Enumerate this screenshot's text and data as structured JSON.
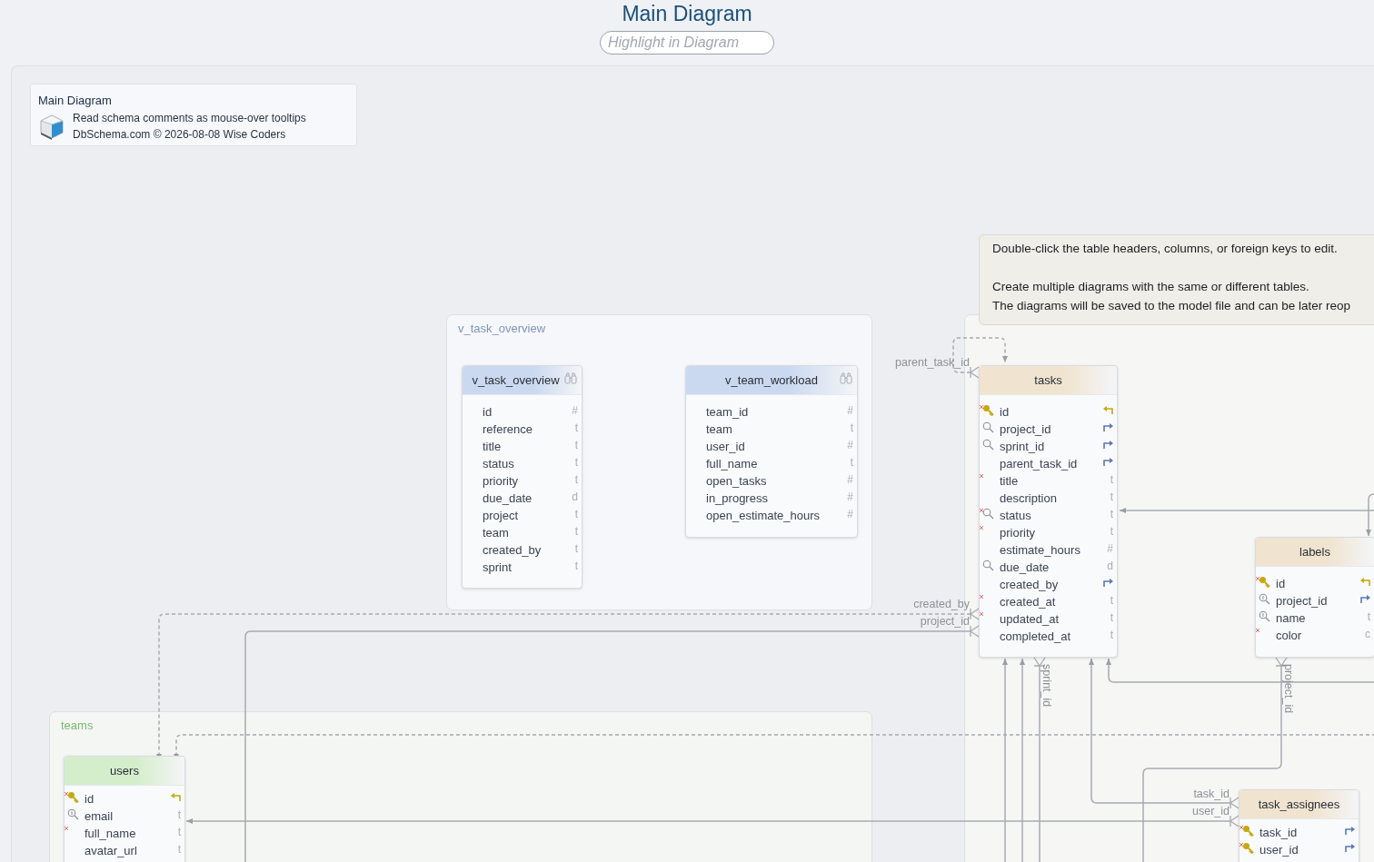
{
  "title": "Main Diagram",
  "search": {
    "placeholder": "Highlight in Diagram"
  },
  "info": {
    "title": "Main Diagram",
    "lines": [
      "Read schema comments as mouse-over tooltips",
      "DbSchema.com © 2026-08-08 Wise Coders"
    ]
  },
  "tooltip": {
    "paragraphs": [
      [
        "Double-click the table headers, columns, or foreign keys to edit."
      ],
      [
        "Create multiple diagrams with the same or different tables.",
        "The diagrams will be saved to the model file and can be later reop"
      ]
    ]
  },
  "groups": [
    {
      "label": "v_task_overview",
      "color": "#7f95ba"
    },
    {
      "label": "teams",
      "color": "#7db877"
    }
  ],
  "tables": [
    {
      "name": "v_task_overview",
      "kind": "view",
      "color": "#cbd9f0",
      "columns": [
        {
          "name": "id",
          "type": "#"
        },
        {
          "name": "reference",
          "type": "t"
        },
        {
          "name": "title",
          "type": "t"
        },
        {
          "name": "status",
          "type": "t"
        },
        {
          "name": "priority",
          "type": "t"
        },
        {
          "name": "due_date",
          "type": "d"
        },
        {
          "name": "project",
          "type": "t"
        },
        {
          "name": "team",
          "type": "t"
        },
        {
          "name": "created_by",
          "type": "t"
        },
        {
          "name": "sprint",
          "type": "t"
        }
      ]
    },
    {
      "name": "v_team_workload",
      "kind": "view",
      "color": "#cbd9f0",
      "columns": [
        {
          "name": "team_id",
          "type": "#"
        },
        {
          "name": "team",
          "type": "t"
        },
        {
          "name": "user_id",
          "type": "#"
        },
        {
          "name": "full_name",
          "type": "t"
        },
        {
          "name": "open_tasks",
          "type": "#"
        },
        {
          "name": "in_progress",
          "type": "#"
        },
        {
          "name": "open_estimate_hours",
          "type": "#"
        }
      ]
    },
    {
      "name": "tasks",
      "kind": "table",
      "color": "#f0e3cf",
      "columns": [
        {
          "name": "id",
          "kind": "pk",
          "required": true
        },
        {
          "name": "project_id",
          "kind": "indexed_fk",
          "required": false
        },
        {
          "name": "sprint_id",
          "kind": "indexed_fk",
          "required": false
        },
        {
          "name": "parent_task_id",
          "kind": "fk",
          "required": false
        },
        {
          "name": "title",
          "kind": "plain",
          "type": "t",
          "required": true
        },
        {
          "name": "description",
          "kind": "plain",
          "type": "t",
          "required": false
        },
        {
          "name": "status",
          "kind": "indexed",
          "type": "t",
          "required": true
        },
        {
          "name": "priority",
          "kind": "plain",
          "type": "t",
          "required": true
        },
        {
          "name": "estimate_hours",
          "kind": "plain",
          "type": "#",
          "required": false
        },
        {
          "name": "due_date",
          "kind": "indexed",
          "type": "d",
          "required": false
        },
        {
          "name": "created_by",
          "kind": "fk",
          "required": false
        },
        {
          "name": "created_at",
          "kind": "plain",
          "type": "t",
          "required": true
        },
        {
          "name": "updated_at",
          "kind": "plain",
          "type": "t",
          "required": true
        },
        {
          "name": "completed_at",
          "kind": "plain",
          "type": "t",
          "required": false
        }
      ]
    },
    {
      "name": "labels",
      "kind": "table",
      "color": "#f0e3cf",
      "columns": [
        {
          "name": "id",
          "kind": "pk",
          "required": true
        },
        {
          "name": "project_id",
          "kind": "unique_fk",
          "required": false
        },
        {
          "name": "name",
          "kind": "unique",
          "type": "t",
          "required": false
        },
        {
          "name": "color",
          "kind": "plain",
          "type": "c",
          "required": true
        }
      ]
    },
    {
      "name": "users",
      "kind": "table",
      "color": "#d4eecb",
      "columns": [
        {
          "name": "id",
          "kind": "pk",
          "required": true
        },
        {
          "name": "email",
          "kind": "unique",
          "type": "t",
          "required": false
        },
        {
          "name": "full_name",
          "kind": "plain",
          "type": "t",
          "required": true
        },
        {
          "name": "avatar_url",
          "kind": "plain",
          "type": "t",
          "required": false
        }
      ]
    },
    {
      "name": "task_assignees",
      "kind": "table",
      "color": "#f0e3cf",
      "columns": [
        {
          "name": "task_id",
          "kind": "key_fk",
          "required": true
        },
        {
          "name": "user_id",
          "kind": "key_fk",
          "required": true
        }
      ]
    }
  ],
  "relations": [
    {
      "label": "parent_task_id",
      "dashed": true
    },
    {
      "label": "created_by",
      "dashed": true
    },
    {
      "label": "project_id",
      "dashed": false
    },
    {
      "label": "sprint_id",
      "dashed": false
    },
    {
      "label": "project_id",
      "dashed": false
    },
    {
      "label": "task_id",
      "dashed": false
    },
    {
      "label": "user_id",
      "dashed": false
    }
  ]
}
